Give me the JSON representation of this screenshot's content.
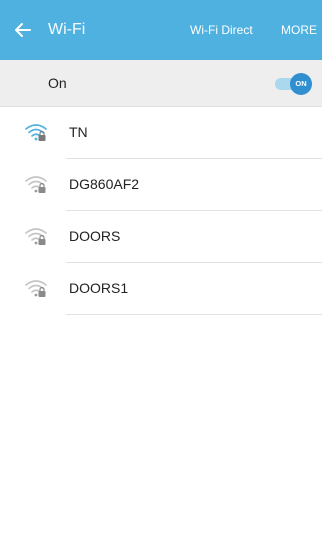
{
  "appbar": {
    "back_icon": "arrow-left-icon",
    "title": "Wi-Fi",
    "wifi_direct": "Wi-Fi Direct",
    "more": "MORE",
    "color": "#4fb1e0"
  },
  "switch": {
    "label": "On",
    "toggle_text": "ON",
    "state": "on"
  },
  "networks": [
    {
      "name": "TN",
      "icon": "wifi-lock-icon",
      "signal": "strong",
      "color": "#4fb1e0"
    },
    {
      "name": "DG860AF2",
      "icon": "wifi-lock-icon",
      "signal": "weak",
      "color": "#b8b8b8"
    },
    {
      "name": "DOORS",
      "icon": "wifi-lock-icon",
      "signal": "weak",
      "color": "#b8b8b8"
    },
    {
      "name": "DOORS1",
      "icon": "wifi-lock-icon",
      "signal": "weak",
      "color": "#b8b8b8"
    }
  ]
}
